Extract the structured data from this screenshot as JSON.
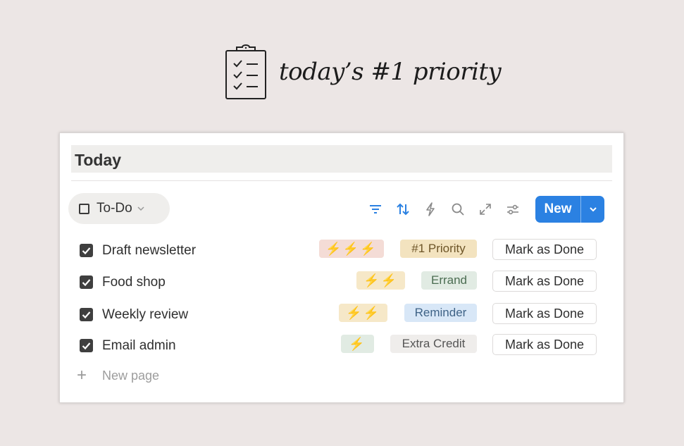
{
  "header": {
    "title": "today’s #1 priority",
    "icon": "clipboard-checklist-icon"
  },
  "card": {
    "title": "Today",
    "view": {
      "label": "To-Do",
      "icon": "checkbox-outline-icon"
    },
    "toolbar": {
      "icons": [
        "filter-icon",
        "sort-icon",
        "automation-lightning-icon",
        "search-icon",
        "expand-icon",
        "settings-sliders-icon"
      ],
      "new_label": "New"
    },
    "tasks": [
      {
        "name": "Draft newsletter",
        "checked": true,
        "bolts": "⚡⚡⚡",
        "tag": "#1 Priority",
        "action": "Mark as Done"
      },
      {
        "name": "Food shop",
        "checked": true,
        "bolts": "⚡⚡",
        "tag": "Errand",
        "action": "Mark as Done"
      },
      {
        "name": "Weekly review",
        "checked": true,
        "bolts": "⚡⚡",
        "tag": "Reminder",
        "action": "Mark as Done"
      },
      {
        "name": "Email admin",
        "checked": true,
        "bolts": "⚡",
        "tag": "Extra Credit",
        "action": "Mark as Done"
      }
    ],
    "new_page_label": "New page"
  },
  "colors": {
    "page_background": "#ece6e5",
    "accent": "#2b81e2",
    "tag_priority": "#f3e3bf",
    "tag_errand": "#e1ebe3",
    "tag_reminder": "#d8e7f7",
    "tag_extra_credit": "#efedeb",
    "bolt_red_bg": "#f4dcd6",
    "bolt_yellow_bg": "#f6e8c8",
    "bolt_green_bg": "#e1ebe3"
  }
}
